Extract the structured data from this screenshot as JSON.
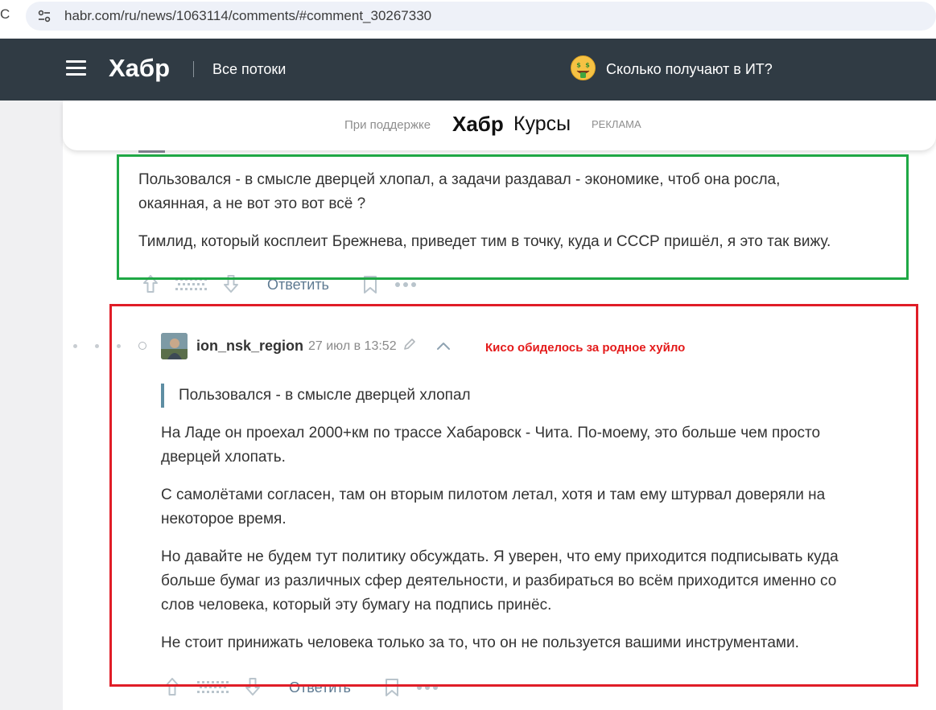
{
  "browser": {
    "url": "habr.com/ru/news/1063114/comments/#comment_30267330",
    "reload_fragment": "C"
  },
  "header": {
    "logo": "Хабр",
    "flows_label": "Все потоки",
    "salary_link": "Сколько получают в ИТ?"
  },
  "sponsor": {
    "supported_by": "При поддержке",
    "brand": "Хабр",
    "product": "Курсы",
    "ad_label": "РЕКЛАМА"
  },
  "comment_parent": {
    "paragraphs": [
      "Пользовался - в смысле дверцей хлопал, а задачи раздавал - экономике, чтоб она росла,",
      "окаянная, а не вот это вот всё ?",
      "Тимлид, который косплеит Брежнева, приведет тим в точку, куда и СССР пришёл, я это так вижу."
    ],
    "reply_label": "Ответить"
  },
  "comment_reply": {
    "username": "ion_nsk_region",
    "time": "27 июл в 13:52",
    "quote": "Пользовался - в смысле дверцей хлопал",
    "paragraphs": [
      [
        "На Ладе он проехал 2000+км по трассе Хабаровск - Чита. По-моему, это больше чем просто",
        "дверцей хлопать."
      ],
      [
        "С самолётами согласен, там он вторым пилотом летал, хотя и там ему штурвал доверяли на",
        "некоторое время."
      ],
      [
        "Но давайте не будем тут политику обсуждать. Я уверен, что ему приходится подписывать куда",
        "больше бумаг из различных сфер деятельности, и разбираться во всём приходится именно со",
        "слов человека, который эту бумагу на подпись принёс."
      ],
      [
        "Не стоит принижать человека только за то, что он не пользуется вашими инструментами."
      ]
    ],
    "reply_label": "Ответить"
  },
  "annotation": {
    "text": "Кисо обиделось за родное хуйло",
    "color": "#e41b1b"
  },
  "colors": {
    "header_bg": "#303b44",
    "link": "#5e7a92",
    "green_box": "#1fa845",
    "red_box": "#e01d27"
  }
}
